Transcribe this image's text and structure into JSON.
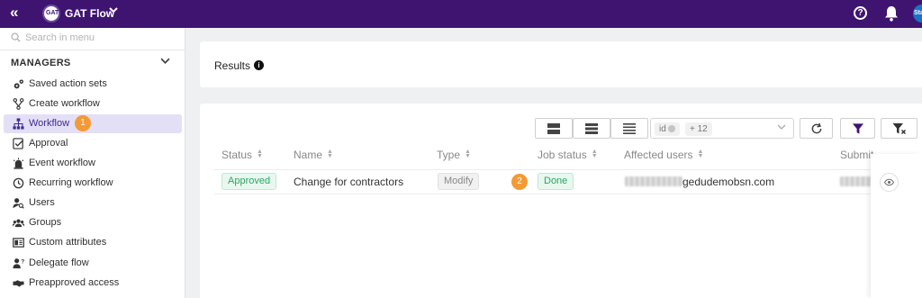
{
  "topbar": {
    "collapse_icon": "double-chevron-left-icon",
    "app_initials": "GAT",
    "app_name": "GAT Flow",
    "help_glyph": "?",
    "avatar_text": "Sta",
    "colors": {
      "topbar_bg": "#3e1470"
    }
  },
  "sidebar": {
    "search_placeholder": "Search in menu",
    "section_title": "MANAGERS",
    "items": [
      {
        "label": "Saved action sets",
        "icon": "cogs-icon",
        "active": false
      },
      {
        "label": "Create workflow",
        "icon": "branch-icon",
        "active": false
      },
      {
        "label": "Workflow",
        "icon": "sitemap-icon",
        "active": true,
        "step_marker": "1"
      },
      {
        "label": "Approval",
        "icon": "checklist-icon",
        "active": false
      },
      {
        "label": "Event workflow",
        "icon": "siren-icon",
        "active": false
      },
      {
        "label": "Recurring workflow",
        "icon": "history-icon",
        "active": false
      },
      {
        "label": "Users",
        "icon": "user-search-icon",
        "active": false
      },
      {
        "label": "Groups",
        "icon": "group-icon",
        "active": false
      },
      {
        "label": "Custom attributes",
        "icon": "id-card-icon",
        "active": false
      },
      {
        "label": "Delegate flow",
        "icon": "user-question-icon",
        "active": false
      },
      {
        "label": "Preapproved access",
        "icon": "handshake-icon",
        "active": false
      }
    ]
  },
  "results": {
    "title": "Results",
    "info_glyph": "i"
  },
  "toolbar": {
    "chip_id": "id",
    "chip_more": "+ 12",
    "icons": [
      "density-large-icon",
      "density-medium-icon",
      "density-compact-icon",
      "refresh-icon",
      "filter-icon",
      "clear-filter-icon"
    ]
  },
  "table": {
    "columns": [
      "Status",
      "Name",
      "Type",
      "Job status",
      "Affected users",
      "Submit"
    ],
    "rows": [
      {
        "status": "Approved",
        "name": "Change for contractors",
        "type": "Modify",
        "step_marker": "2",
        "job_status": "Done",
        "affected_users_visible": "gedudemobsn.com"
      }
    ]
  }
}
